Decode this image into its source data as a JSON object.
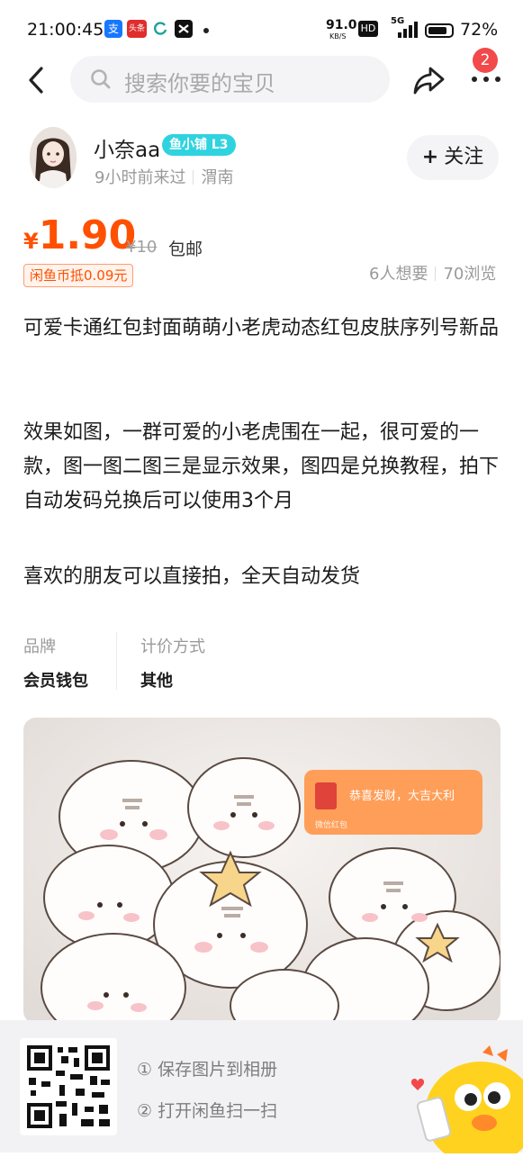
{
  "status_bar": {
    "time": "21:00:45",
    "app_icons": [
      "alipay-icon",
      "toutiao-icon",
      "refresh-icon",
      "capcut-icon"
    ],
    "alipay_glyph": "支",
    "toutiao_glyph": "头条",
    "net_speed": "91.0",
    "net_unit": "KB/S",
    "hd": "HD",
    "network": "5G",
    "battery": "72%"
  },
  "nav": {
    "search_placeholder": "搜索你要的宝贝",
    "notification_count": "2"
  },
  "seller": {
    "name": "小奈aa",
    "shop_badge": "鱼小铺 L3",
    "last_seen": "9小时前来过",
    "location": "渭南",
    "follow_label": "关注"
  },
  "price": {
    "currency": "¥",
    "value": "1.90",
    "original": "¥10",
    "shipping": "包邮",
    "coin_discount": "闲鱼币抵0.09元",
    "wants": "6人想要",
    "views": "70浏览"
  },
  "description": {
    "title": "可爱卡通红包封面萌萌小老虎动态红包皮肤序列号新品",
    "paragraph1": "效果如图，一群可爱的小老虎围在一起，很可爱的一款，图一图二图三是显示效果，图四是兑换教程，拍下自动发码兑换后可以使用3个月",
    "paragraph2": "喜欢的朋友可以直接拍，全天自动发货"
  },
  "attributes": [
    {
      "label": "品牌",
      "value": "会员钱包"
    },
    {
      "label": "计价方式",
      "value": "其他"
    }
  ],
  "product_image": {
    "overlay_text": "恭喜发财，大吉大利",
    "overlay_sub": "微信红包"
  },
  "bottom_panel": {
    "step1": "① 保存图片到相册",
    "step2": "② 打开闲鱼扫一扫"
  },
  "colors": {
    "price": "#ff5000",
    "shop_badge": "#2fd3df",
    "notification": "#f2494b"
  }
}
